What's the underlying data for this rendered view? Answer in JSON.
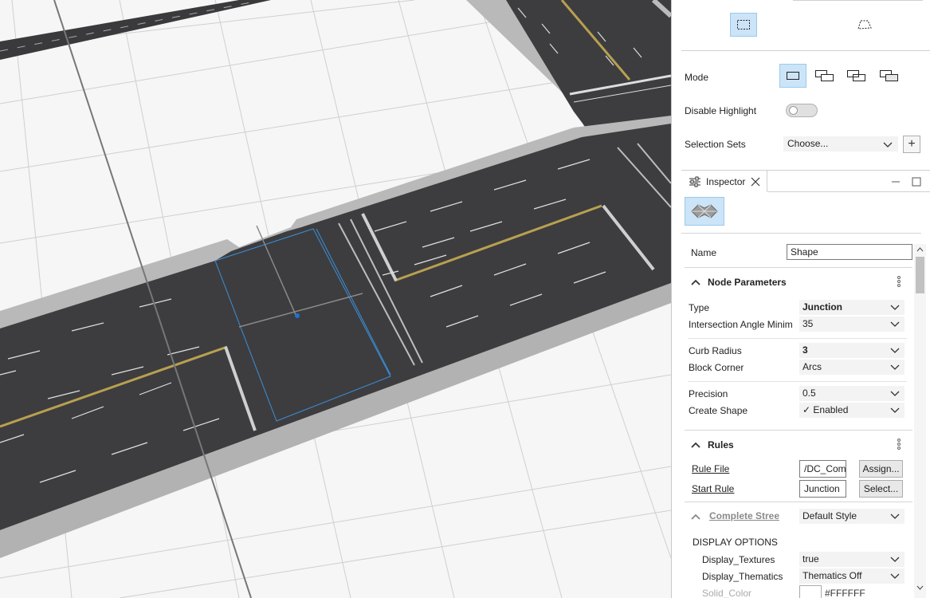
{
  "selection_panel": {
    "rect_tool_icon": "rectangle-select-icon",
    "lasso_tool_icon": "lasso-select-icon",
    "mode_label": "Mode",
    "mode_buttons": [
      {
        "icon": "new-selection-icon",
        "active": true
      },
      {
        "icon": "add-selection-icon",
        "active": false
      },
      {
        "icon": "subtract-selection-icon",
        "active": false
      },
      {
        "icon": "toggle-selection-icon",
        "active": false
      }
    ],
    "disable_highlight_label": "Disable Highlight",
    "disable_highlight_on": false,
    "selection_sets_label": "Selection Sets",
    "selection_sets_value": "Choose...",
    "add_button": "+"
  },
  "inspector": {
    "tab_label": "Inspector",
    "name_label": "Name",
    "name_value": "Shape",
    "node_parameters": {
      "title": "Node Parameters",
      "type_label": "Type",
      "type_value": "Junction",
      "angle_label": "Intersection Angle Minim",
      "angle_value": "35",
      "curb_label": "Curb Radius",
      "curb_value": "3",
      "corner_label": "Block Corner",
      "corner_value": "Arcs",
      "precision_label": "Precision",
      "precision_value": "0.5",
      "create_shape_label": "Create Shape",
      "create_shape_value": "✓ Enabled"
    },
    "rules": {
      "title": "Rules",
      "rule_file_label": "Rule File",
      "rule_file_value": "/DC_Com",
      "assign_button": "Assign...",
      "start_rule_label": "Start Rule",
      "start_rule_value": "Junction",
      "select_button": "Select..."
    },
    "style": {
      "link_label": "Complete Stree",
      "value": "Default Style"
    },
    "display_options": {
      "title": "DISPLAY OPTIONS",
      "textures_label": "Display_Textures",
      "textures_value": "true",
      "thematics_label": "Display_Thematics",
      "thematics_value": "Thematics Off",
      "solid_color_label": "Solid_Color",
      "solid_color_value": "#FFFFFF"
    }
  },
  "colors": {
    "accent_bg": "#cce4f7",
    "accent_border": "#99c9ef",
    "road_asphalt": "#3d3d3f",
    "curb": "#b9b9b9",
    "center_line": "#b8a050"
  }
}
